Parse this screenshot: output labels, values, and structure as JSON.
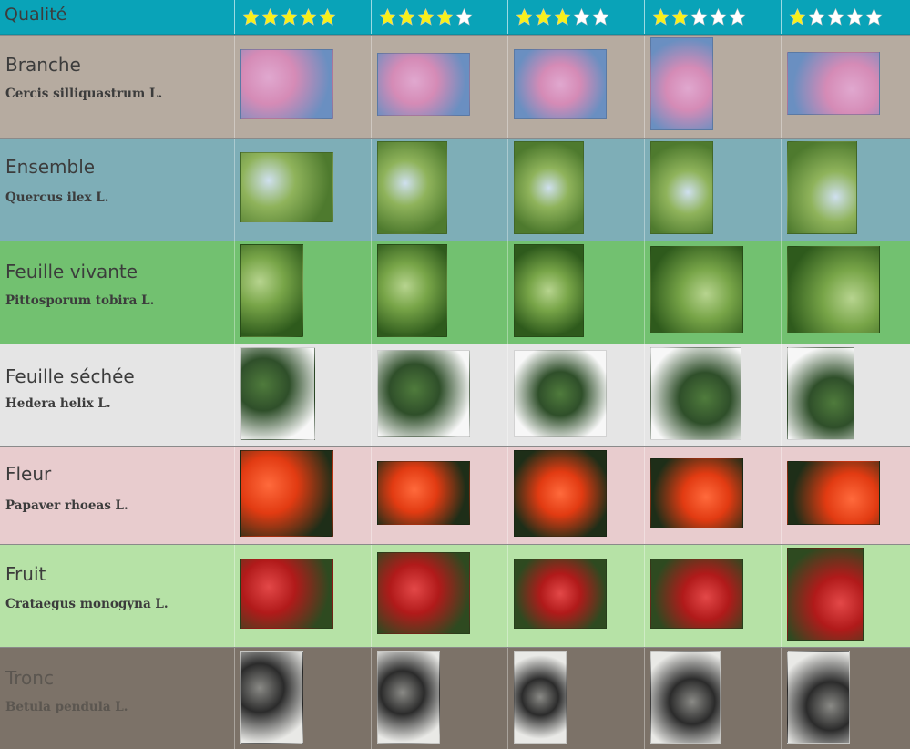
{
  "header": {
    "label": "Qualité",
    "ratings": [
      5,
      4,
      3,
      2,
      1
    ],
    "star_filled_color": "#f7f01a",
    "star_empty_color": "#ffffff"
  },
  "rows": [
    {
      "common": "Branche",
      "latin": "Cercis silliquastrum L.",
      "bg": "#b6aba0",
      "text_color": "#3c3c3c",
      "thumbs": [
        {
          "desc": "pink blossoms on sky"
        },
        {
          "desc": "pink blossoms"
        },
        {
          "desc": "pink flowering branches"
        },
        {
          "desc": "flowering tree close"
        },
        {
          "desc": "dark branches pink"
        }
      ]
    },
    {
      "common": "Ensemble",
      "latin": "Quercus ilex L.",
      "bg": "#7eaeb7",
      "text_color": "#3c3c3c",
      "thumbs": [
        {
          "desc": "oak tree"
        },
        {
          "desc": "oak on hill"
        },
        {
          "desc": "tree sky"
        },
        {
          "desc": "forest"
        },
        {
          "desc": "forest path"
        }
      ]
    },
    {
      "common": "Feuille vivante",
      "latin": "Pittosporum tobira L.",
      "bg": "#72c170",
      "text_color": "#3c3c3c",
      "thumbs": [
        {
          "desc": "leaf"
        },
        {
          "desc": "leaves"
        },
        {
          "desc": "dark leaves"
        },
        {
          "desc": "leaves red"
        },
        {
          "desc": "leaf on stone"
        }
      ]
    },
    {
      "common": "Feuille séchée",
      "latin": "Hedera helix L.",
      "bg": "#e5e5e5",
      "text_color": "#3c3c3c",
      "thumbs": [
        {
          "desc": "ivy leaf white"
        },
        {
          "desc": "ivy leaf dark"
        },
        {
          "desc": "ivy leaf grey"
        },
        {
          "desc": "two ivy leaves"
        },
        {
          "desc": "ivy with ruler"
        }
      ]
    },
    {
      "common": "Fleur",
      "latin": "Papaver rhoeas L.",
      "bg": "#e8ccce",
      "text_color": "#3c3c3c",
      "thumbs": [
        {
          "desc": "poppy close"
        },
        {
          "desc": "poppy"
        },
        {
          "desc": "poppy in hand"
        },
        {
          "desc": "poppy in grass"
        },
        {
          "desc": "poppy bud"
        }
      ]
    },
    {
      "common": "Fruit",
      "latin": "Crataegus monogyna L.",
      "bg": "#b6e2a6",
      "text_color": "#3c3c3c",
      "thumbs": [
        {
          "desc": "red berries"
        },
        {
          "desc": "berries branch"
        },
        {
          "desc": "berries leaves"
        },
        {
          "desc": "bush berries"
        },
        {
          "desc": "dried fruit"
        }
      ]
    },
    {
      "common": "Tronc",
      "latin": "Betula pendula L.",
      "bg": "#7c7268",
      "text_color": "#5b5650",
      "thumbs": [
        {
          "desc": "birch bark"
        },
        {
          "desc": "birch trunk"
        },
        {
          "desc": "birch trunk green"
        },
        {
          "desc": "birch forest"
        },
        {
          "desc": "birch forest light"
        }
      ]
    }
  ]
}
